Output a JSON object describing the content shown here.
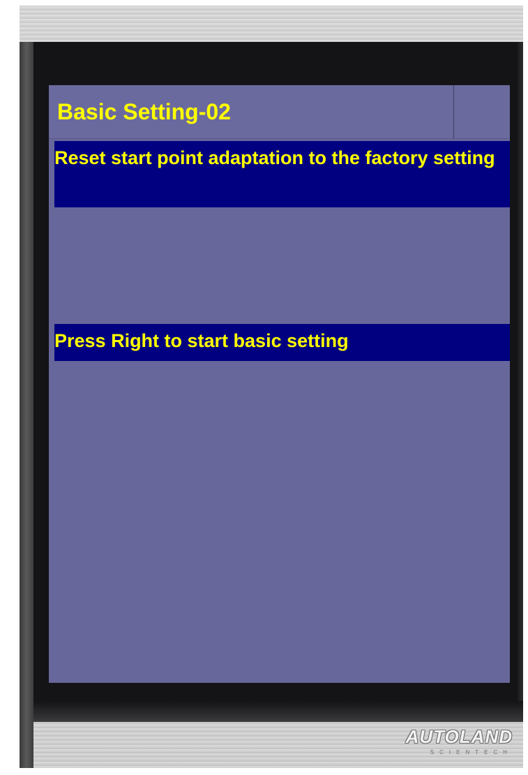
{
  "screen": {
    "title": "Basic Setting-02",
    "messages": [
      "Reset start point adaptation to the factory setting",
      "Press Right to start basic setting"
    ]
  },
  "branding": {
    "logo_text": "AUTOLAND",
    "logo_subtext": "SCIENTECH"
  },
  "colors": {
    "screen_bg": "#67679b",
    "highlight_bg": "#000080",
    "text": "#ffff00"
  }
}
